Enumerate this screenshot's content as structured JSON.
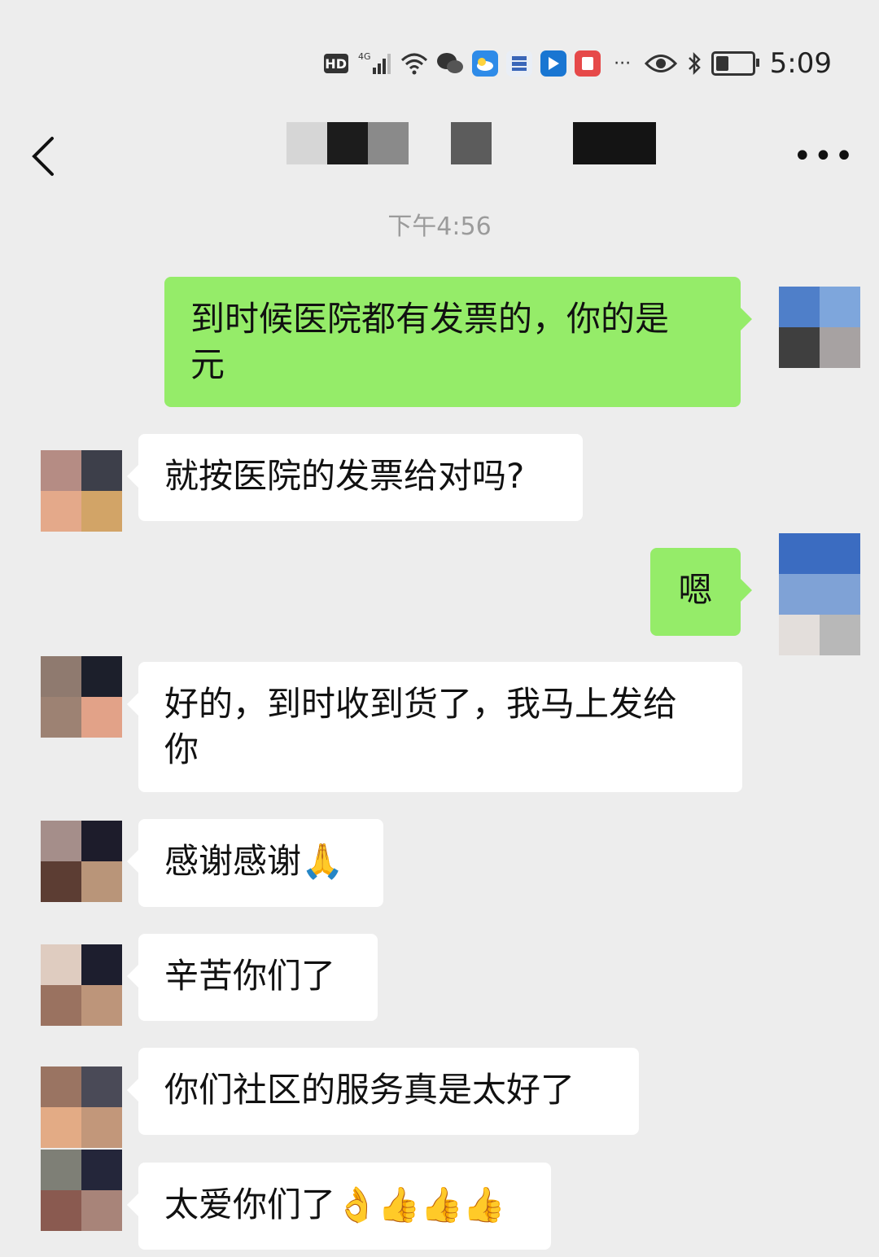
{
  "status_bar": {
    "hd_label": "HD",
    "network_label": "4G",
    "time": "5:09",
    "overflow_label": "···",
    "battery_level": 0.35
  },
  "nav": {
    "more_label": "•••"
  },
  "chat": {
    "timestamp": "下午4:56",
    "messages": [
      {
        "side": "out",
        "text": "到时候医院都有发票的，你的是\n元"
      },
      {
        "side": "in",
        "text": "就按医院的发票给对吗?"
      },
      {
        "side": "out",
        "text": "嗯"
      },
      {
        "side": "in",
        "text": "好的，到时收到货了，我马上发给\n你"
      },
      {
        "side": "in",
        "text": "感谢感谢🙏"
      },
      {
        "side": "in",
        "text": "辛苦你们了"
      },
      {
        "side": "in",
        "text": "你们社区的服务真是太好了"
      },
      {
        "side": "in",
        "text": "太爱你们了👌👍👍👍"
      }
    ]
  },
  "colors": {
    "background": "#ededed",
    "bubble_out": "#95ec69",
    "bubble_in": "#ffffff",
    "timestamp_text": "#9b9b9b"
  }
}
